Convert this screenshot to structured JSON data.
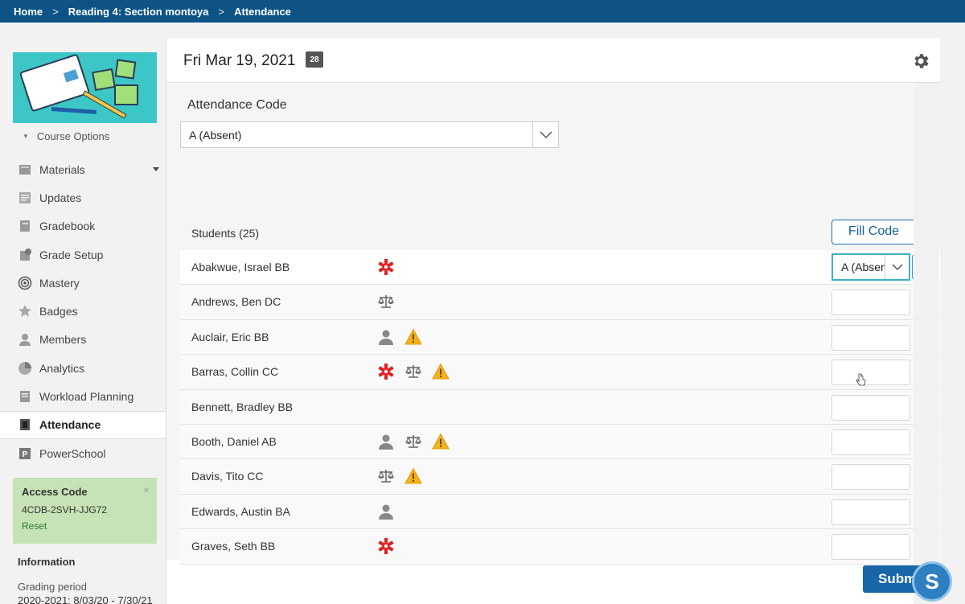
{
  "breadcrumb": {
    "items": [
      "Home",
      "Reading 4: Section montoya",
      "Attendance"
    ],
    "separator": ">"
  },
  "sidebar": {
    "course_options": "Course Options",
    "items": [
      {
        "label": "Materials",
        "icon": "materials-icon"
      },
      {
        "label": "Updates",
        "icon": "updates-icon"
      },
      {
        "label": "Gradebook",
        "icon": "gradebook-icon"
      },
      {
        "label": "Grade Setup",
        "icon": "grade-setup-icon"
      },
      {
        "label": "Mastery",
        "icon": "mastery-icon"
      },
      {
        "label": "Badges",
        "icon": "badges-icon"
      },
      {
        "label": "Members",
        "icon": "members-icon"
      },
      {
        "label": "Analytics",
        "icon": "analytics-icon"
      },
      {
        "label": "Workload Planning",
        "icon": "workload-icon"
      },
      {
        "label": "Attendance",
        "icon": "attendance-icon"
      },
      {
        "label": "PowerSchool",
        "icon": "powerschool-icon"
      }
    ],
    "access": {
      "title": "Access Code",
      "code": "4CDB-2SVH-JJG72",
      "reset": "Reset",
      "close": "×"
    },
    "information": {
      "title": "Information",
      "label": "Grading period",
      "value": "2020-2021: 8/03/20 - 7/30/21"
    }
  },
  "main": {
    "date": "Fri Mar 19, 2021",
    "calendar_day": "28",
    "attendance_code_label": "Attendance Code",
    "attendance_code_value": "A (Absent)",
    "students_label": "Students (25)",
    "fill_code": "Fill Code",
    "submit": "Submi",
    "logo_letter": "S"
  },
  "students": [
    {
      "name": "Abakwue, Israel BB",
      "icons": [
        "medical"
      ],
      "code": "A (Absent)"
    },
    {
      "name": "Andrews, Ben DC",
      "icons": [
        "scale"
      ],
      "code": ""
    },
    {
      "name": "Auclair, Eric BB",
      "icons": [
        "person",
        "warning"
      ],
      "code": ""
    },
    {
      "name": "Barras, Collin CC",
      "icons": [
        "medical",
        "scale",
        "warning"
      ],
      "code": ""
    },
    {
      "name": "Bennett, Bradley BB",
      "icons": [],
      "code": ""
    },
    {
      "name": "Booth, Daniel AB",
      "icons": [
        "person",
        "scale",
        "warning"
      ],
      "code": ""
    },
    {
      "name": "Davis, Tito CC",
      "icons": [
        "scale",
        "warning"
      ],
      "code": ""
    },
    {
      "name": "Edwards, Austin BA",
      "icons": [
        "person"
      ],
      "code": ""
    },
    {
      "name": "Graves, Seth BB",
      "icons": [
        "medical"
      ],
      "code": ""
    }
  ],
  "colors": {
    "topbar": "#0d5386",
    "accent": "#1a73b8",
    "medical": "#e02020",
    "warning": "#f2b21b",
    "access_bg": "#c5e3b6"
  }
}
